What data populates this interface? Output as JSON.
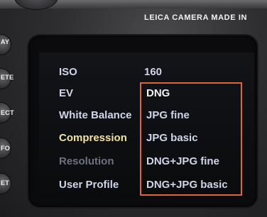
{
  "header": {
    "brand_text": "LEICA CAMERA   MADE IN"
  },
  "side_buttons": [
    {
      "label": "AY"
    },
    {
      "label": "ETE"
    },
    {
      "label": "ECT"
    },
    {
      "label": "FO"
    },
    {
      "label": "ET"
    }
  ],
  "menu": {
    "items": [
      {
        "label": "ISO",
        "value": "160",
        "state": "normal"
      },
      {
        "label": "EV",
        "state": "normal"
      },
      {
        "label": "White Balance",
        "state": "normal"
      },
      {
        "label": "Compression",
        "state": "selected"
      },
      {
        "label": "Resolution",
        "state": "disabled"
      },
      {
        "label": "User Profile",
        "state": "normal"
      }
    ]
  },
  "dropdown": {
    "options": [
      "DNG",
      "JPG fine",
      "JPG basic",
      "DNG+JPG fine",
      "DNG+JPG basic"
    ],
    "highlighted": "DNG",
    "border_color": "#e2643f"
  },
  "colors": {
    "menu_text": "#cfd6ea",
    "selected_text": "#f3e39a",
    "disabled_text": "#6f7380"
  }
}
